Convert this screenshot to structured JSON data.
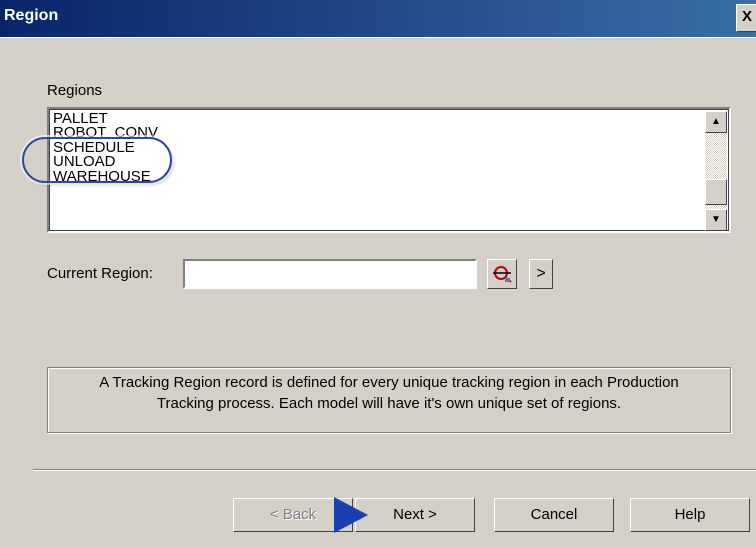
{
  "window": {
    "title": "Region",
    "close_label": "X"
  },
  "regions": {
    "label": "Regions",
    "items": [
      "PALLET",
      "ROBOT_CONV",
      "SCHEDULE",
      "UNLOAD",
      "WAREHOUSE"
    ],
    "scroll_up": "▲",
    "scroll_down": "▼"
  },
  "current_region": {
    "label": "Current Region:",
    "value": "",
    "next_label": ">"
  },
  "info": {
    "line1": "A Tracking Region record is defined for every unique tracking region in each Production",
    "line2": "Tracking process.  Each model will have it's own unique set of regions."
  },
  "buttons": {
    "back": "< Back",
    "next": "Next >",
    "cancel": "Cancel",
    "help": "Help"
  },
  "colors": {
    "accent": "#1a3fb0",
    "titlebar": "#0a246a",
    "background": "#d4d0c8"
  }
}
